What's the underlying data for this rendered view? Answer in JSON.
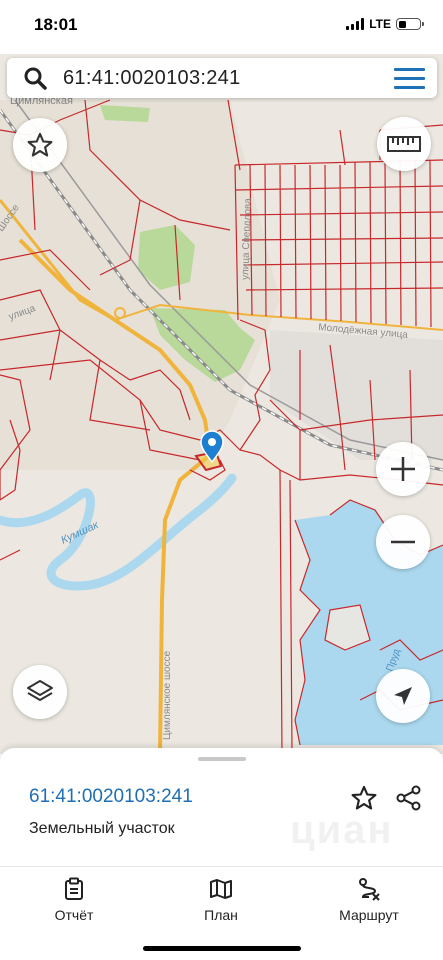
{
  "status_bar": {
    "time": "18:01",
    "network": "LTE",
    "battery_level": 0.35
  },
  "search": {
    "query": "61:41:0020103:241"
  },
  "map": {
    "labels": {
      "top_partial": "Цимлянская",
      "road_vertical": "улица Свердлова",
      "street_right": "Молодёжная улица",
      "road_left": "Шоссе",
      "road_left2": "улица",
      "river": "Кумшак",
      "highway": "Цимлянское шоссе",
      "lake": "Пруд"
    },
    "colors": {
      "parcel": "#c8282b",
      "road": "#f0b43c",
      "green": "#b9d99a",
      "water": "#abd8ee",
      "land": "#ece8e1"
    }
  },
  "sheet": {
    "parcel_id": "61:41:0020103:241",
    "parcel_type": "Земельный участок",
    "watermark": "циан"
  },
  "tabs": [
    {
      "label": "Отчёт",
      "icon": "report-icon"
    },
    {
      "label": "План",
      "icon": "map-plan-icon"
    },
    {
      "label": "Маршрут",
      "icon": "route-icon"
    }
  ],
  "buttons": {
    "favorite": "star-icon",
    "ruler": "ruler-icon",
    "zoom_in": "plus-icon",
    "zoom_out": "minus-icon",
    "layers": "layers-icon",
    "locate": "navigation-arrow-icon"
  }
}
